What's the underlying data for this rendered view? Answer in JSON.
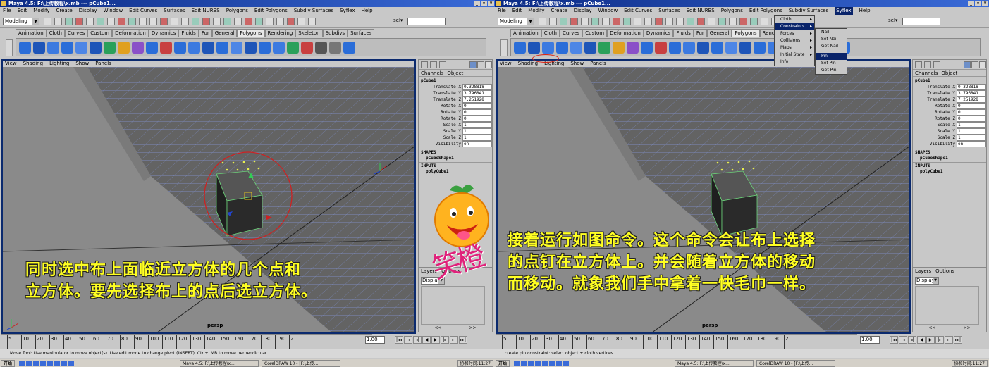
{
  "left_window": {
    "title": "Maya 4.5: F:\\上传教程\\x.mb  ---  pCube1...",
    "menu": [
      "File",
      "Edit",
      "Modify",
      "Create",
      "Display",
      "Window",
      "Edit Curves",
      "Surfaces",
      "Edit NURBS",
      "Polygons",
      "Edit Polygons",
      "Subdiv Surfaces",
      "Syflex",
      "Help"
    ],
    "mode": "Modeling",
    "sel_label": "sel▾",
    "shelf_tabs": [
      "Animation",
      "Cloth",
      "Curves",
      "Custom",
      "Deformation",
      "Dynamics",
      "Fluids",
      "Fur",
      "General",
      "Polygons",
      "Rendering",
      "Skeleton",
      "Subdivs",
      "Surfaces"
    ],
    "active_shelf_tab": "Polygons",
    "viewport_menu": [
      "View",
      "Shading",
      "Lighting",
      "Show",
      "Panels"
    ],
    "camera": "persp",
    "caption": [
      "同时选中布上面临近立方体的几个点和",
      "立方体。要先选择布上的点后选立方体。"
    ],
    "help_line": "Move Tool: Use manipulator to move object(s). Use edit mode to change pivot (INSERT). Ctrl+LMB to move perpendicular."
  },
  "right_window": {
    "title": "Maya 4.5: F:\\上传教程\\x.mb  ---  pCube1...",
    "menu": [
      "File",
      "Edit",
      "Modify",
      "Create",
      "Display",
      "Window",
      "Edit Curves",
      "Surfaces",
      "Edit NURBS",
      "Polygons",
      "Edit Polygons",
      "Subdiv Surfaces",
      "Syflex",
      "Help"
    ],
    "active_menu": "Syflex",
    "syflex_menu": [
      "Cloth",
      "Constraints",
      "Forces",
      "Collisions",
      "Maps",
      "Initial State",
      "Info"
    ],
    "constraints_submenu": [
      "Nail",
      "Set Nail",
      "Get Nail",
      "Pin",
      "Set Pin",
      "Get Pin"
    ],
    "highlighted_item": "Pin",
    "camera": "persp",
    "caption": [
      "接着运行如图命令。这个命令会让布上选择",
      "的点钉在立方体上。并会随着立方体的移动",
      "而移动。就象我们手中拿着一快毛巾一样。"
    ],
    "help_line": "create pin constraint: select object + cloth vertices"
  },
  "channel_box": {
    "tabs": [
      "Channels",
      "Object"
    ],
    "object": "pCube1",
    "attributes": [
      {
        "name": "Translate X",
        "value": "0.328818"
      },
      {
        "name": "Translate Y",
        "value": "3.796841"
      },
      {
        "name": "Translate Z",
        "value": "7.251928"
      },
      {
        "name": "Rotate X",
        "value": "0"
      },
      {
        "name": "Rotate Y",
        "value": "0"
      },
      {
        "name": "Rotate Z",
        "value": "0"
      },
      {
        "name": "Scale X",
        "value": "1"
      },
      {
        "name": "Scale Y",
        "value": "1"
      },
      {
        "name": "Scale Z",
        "value": "1"
      },
      {
        "name": "Visibility",
        "value": "on"
      }
    ],
    "shapes_label": "SHAPES",
    "shape": "pCubeShape1",
    "inputs_label": "INPUTS",
    "input": "polyCube1",
    "layer_tabs": [
      "Layers",
      "Options"
    ],
    "display": "Display",
    "nav": [
      "<<",
      ">>"
    ]
  },
  "timeline": {
    "ticks": [
      "5",
      "10",
      "20",
      "30",
      "40",
      "50",
      "60",
      "70",
      "80",
      "90",
      "100",
      "110",
      "120",
      "130",
      "140",
      "150",
      "160",
      "170",
      "180",
      "190"
    ],
    "end_mark": "2",
    "current_frame": "1.00"
  },
  "taskbar": {
    "start": "开始",
    "tasks": [
      "Maya 4.5: F:\\上传教程\\x...",
      "CorelDRAW 10 - [F:\\上传..."
    ],
    "clock": "协和时间:11:27"
  },
  "watermark": "笑橙",
  "colors": {
    "caption": "#ffff22",
    "titlebar": "#0b2a84",
    "viewport_border": "#0b2a6e",
    "watermark": "#e0207a",
    "selection_circle": "#cc2222"
  }
}
